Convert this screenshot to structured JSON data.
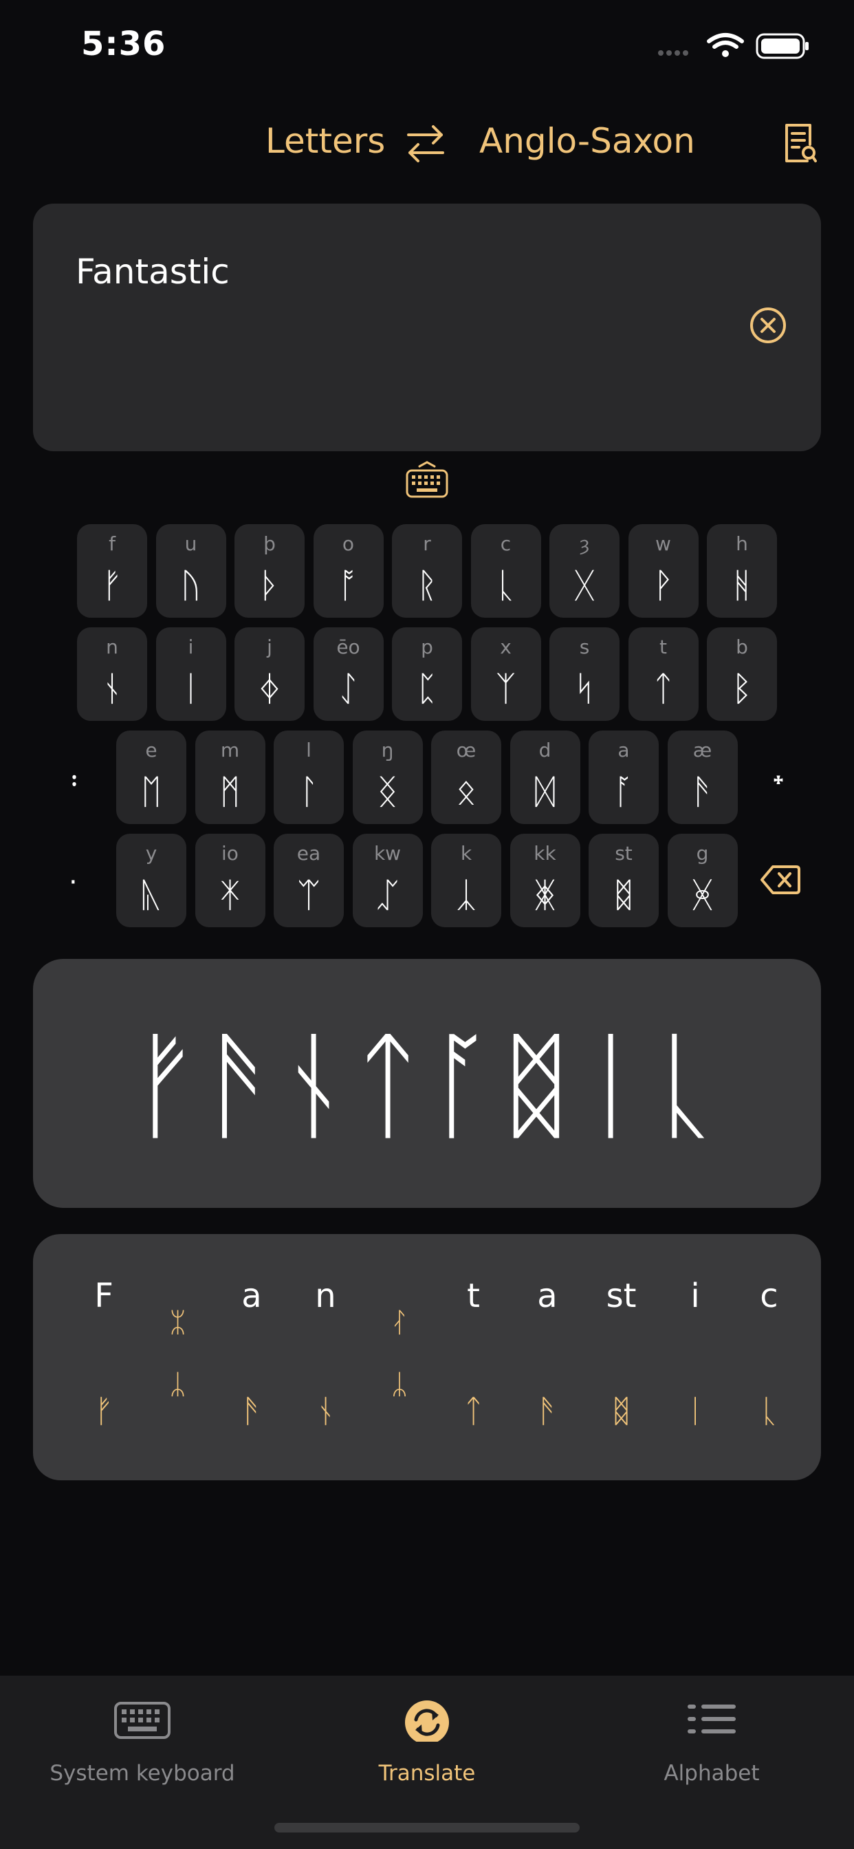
{
  "status_bar": {
    "time": "5:36"
  },
  "header": {
    "from_label": "Letters",
    "to_label": "Anglo-Saxon",
    "swap_icon": "swap-arrows-icon",
    "dictionary_icon": "document-search-icon"
  },
  "input": {
    "value": "Fantastic"
  },
  "keyboard": {
    "row1": [
      {
        "lat": "f",
        "rune": "ᚠ"
      },
      {
        "lat": "u",
        "rune": "ᚢ"
      },
      {
        "lat": "þ",
        "rune": "ᚦ"
      },
      {
        "lat": "o",
        "rune": "ᚩ"
      },
      {
        "lat": "r",
        "rune": "ᚱ"
      },
      {
        "lat": "c",
        "rune": "ᚳ"
      },
      {
        "lat": "ȝ",
        "rune": "ᚷ"
      },
      {
        "lat": "w",
        "rune": "ᚹ"
      },
      {
        "lat": "h",
        "rune": "ᚻ"
      }
    ],
    "row2": [
      {
        "lat": "n",
        "rune": "ᚾ"
      },
      {
        "lat": "i",
        "rune": "ᛁ"
      },
      {
        "lat": "j",
        "rune": "ᛄ"
      },
      {
        "lat": "ēo",
        "rune": "ᛇ"
      },
      {
        "lat": "p",
        "rune": "ᛈ"
      },
      {
        "lat": "x",
        "rune": "ᛉ"
      },
      {
        "lat": "s",
        "rune": "ᛋ"
      },
      {
        "lat": "t",
        "rune": "ᛏ"
      },
      {
        "lat": "b",
        "rune": "ᛒ"
      }
    ],
    "row3": [
      {
        "lat": "e",
        "rune": "ᛖ"
      },
      {
        "lat": "m",
        "rune": "ᛗ"
      },
      {
        "lat": "l",
        "rune": "ᛚ"
      },
      {
        "lat": "ŋ",
        "rune": "ᛝ"
      },
      {
        "lat": "œ",
        "rune": "ᛟ"
      },
      {
        "lat": "d",
        "rune": "ᛞ"
      },
      {
        "lat": "a",
        "rune": "ᚪ"
      },
      {
        "lat": "æ",
        "rune": "ᚫ"
      }
    ],
    "row4": [
      {
        "lat": "y",
        "rune": "ᚣ"
      },
      {
        "lat": "io",
        "rune": "ᛡ"
      },
      {
        "lat": "ea",
        "rune": "ᛠ"
      },
      {
        "lat": "kw",
        "rune": "ᛢ"
      },
      {
        "lat": "k",
        "rune": "ᛣ"
      },
      {
        "lat": "kk",
        "rune": "ᛤ"
      },
      {
        "lat": "st",
        "rune": "ᛥ"
      },
      {
        "lat": "g",
        "rune": "ᚸ"
      }
    ],
    "side_colon": "᛬",
    "side_cross": "᛭",
    "side_dot": "·",
    "backspace_icon": "backspace-icon",
    "toggle_icon": "keyboard-icon"
  },
  "output": {
    "runes": "ᚠᚫᚾᛏᚪᛥᛁᚳ"
  },
  "breakdown": {
    "items": [
      {
        "lat": "F",
        "rune": "ᚠ"
      },
      {
        "lat": "",
        "rune": "ᛦ",
        "alt1": "ᛯ"
      },
      {
        "lat": "a",
        "rune": "ᚫ"
      },
      {
        "lat": "n",
        "rune": "ᚾ"
      },
      {
        "lat": "",
        "rune": "ᛦ",
        "alt1": "ᛮ"
      },
      {
        "lat": "t",
        "rune": "ᛏ"
      },
      {
        "lat": "a",
        "rune": "ᚫ"
      },
      {
        "lat": "st",
        "rune": "ᛥ"
      },
      {
        "lat": "i",
        "rune": "ᛁ"
      },
      {
        "lat": "c",
        "rune": "ᚳ"
      }
    ]
  },
  "tabs": [
    {
      "label": "System keyboard",
      "icon": "keyboard-icon"
    },
    {
      "label": "Translate",
      "icon": "translate-icon"
    },
    {
      "label": "Alphabet",
      "icon": "list-icon"
    }
  ],
  "colors": {
    "accent": "#f1c47a",
    "background": "#0b0b0d",
    "card": "#29292b",
    "output_card": "#3a3a3c"
  }
}
